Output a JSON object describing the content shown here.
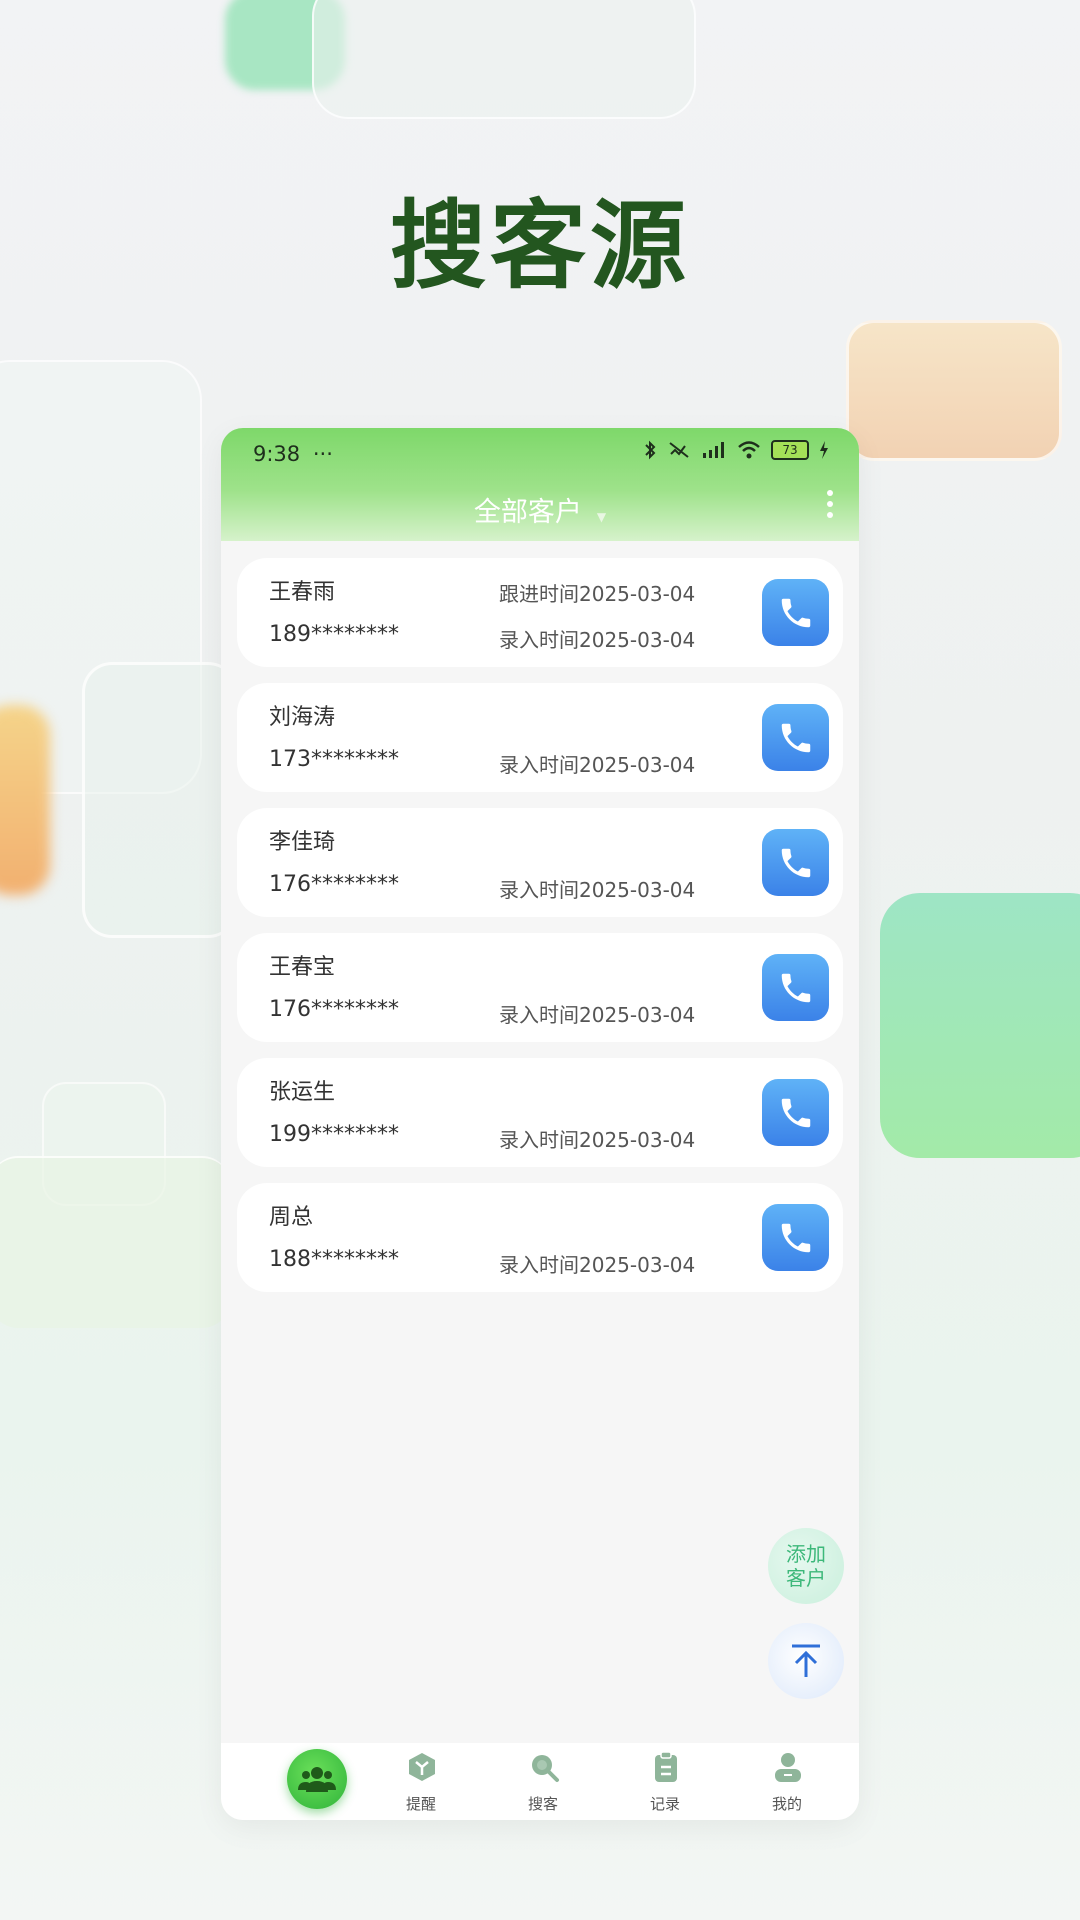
{
  "headline": "搜客源",
  "status_bar": {
    "time": "9:38",
    "dots": "···",
    "battery": "73"
  },
  "header": {
    "title": "全部客户"
  },
  "customers": [
    {
      "name": "王春雨",
      "phone": "189********",
      "follow_time": "跟进时间2025-03-04",
      "entry_time": "录入时间2025-03-04"
    },
    {
      "name": "刘海涛",
      "phone": "173********",
      "follow_time": "",
      "entry_time": "录入时间2025-03-04"
    },
    {
      "name": "李佳琦",
      "phone": "176********",
      "follow_time": "",
      "entry_time": "录入时间2025-03-04"
    },
    {
      "name": "王春宝",
      "phone": "176********",
      "follow_time": "",
      "entry_time": "录入时间2025-03-04"
    },
    {
      "name": "张运生",
      "phone": "199********",
      "follow_time": "",
      "entry_time": "录入时间2025-03-04"
    },
    {
      "name": "周总",
      "phone": "188********",
      "follow_time": "",
      "entry_time": "录入时间2025-03-04"
    }
  ],
  "fab": {
    "add_line1": "添加",
    "add_line2": "客户"
  },
  "bottom_nav": {
    "items": [
      {
        "label": "",
        "icon": "customers-icon"
      },
      {
        "label": "提醒",
        "icon": "reminder-icon"
      },
      {
        "label": "搜客",
        "icon": "search-icon"
      },
      {
        "label": "记录",
        "icon": "clipboard-icon"
      },
      {
        "label": "我的",
        "icon": "profile-icon"
      }
    ]
  },
  "colors": {
    "headline": "#23561f",
    "header_green": "#7ed86a",
    "call_blue": "#3b82e8",
    "nav_icon": "#8fb59a"
  }
}
